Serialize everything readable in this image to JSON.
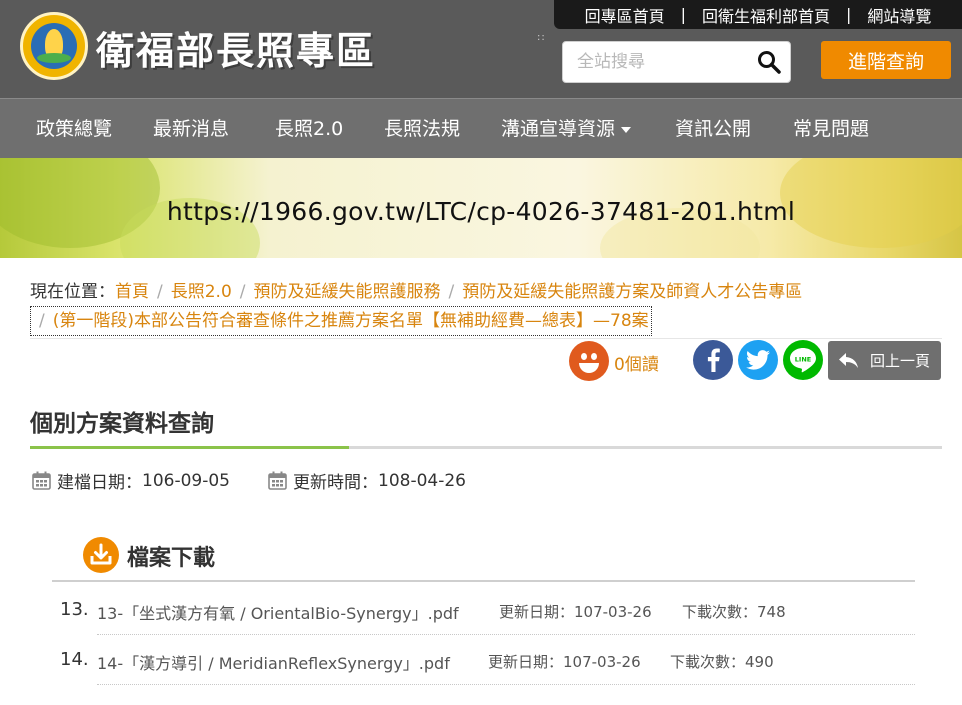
{
  "header": {
    "site_title": "衛福部長照專區",
    "top_links": [
      "回專區首頁",
      "回衛生福利部首頁",
      "網站導覽"
    ],
    "search_placeholder": "全站搜尋",
    "advanced_search": "進階查詢",
    "drag_dots": "::"
  },
  "nav": {
    "items": [
      "政策總覽",
      "最新消息",
      "長照2.0",
      "長照法規",
      "溝通宣導資源",
      "資訊公開",
      "常見問題"
    ]
  },
  "banner": {
    "url": "https://1966.gov.tw/LTC/cp-4026-37481-201.html"
  },
  "breadcrumb": {
    "label": "現在位置：",
    "items": [
      "首頁",
      "長照2.0",
      "預防及延緩失能照護服務",
      "預防及延緩失能照護方案及師資人才公告專區",
      "(第一階段)本部公告符合審查條件之推薦方案名單【無補助經費—總表】—78案"
    ],
    "separator": "/"
  },
  "tools": {
    "views": "0個讀",
    "back_label": "回上一頁",
    "line_label": "LINE"
  },
  "section": {
    "title": "個別方案資料查詢"
  },
  "dates": {
    "created_label": "建檔日期：",
    "created": "106-09-05",
    "updated_label": "更新時間：",
    "updated": "108-04-26"
  },
  "download": {
    "title": "檔案下載",
    "files": [
      {
        "num": "13.",
        "name": "13-「坐式漢方有氧 / OrientalBio-Synergy」.pdf",
        "updated_label": "更新日期：",
        "updated": "107-03-26",
        "count_label": "下載次數：",
        "count": "748"
      },
      {
        "num": "14.",
        "name": "14-「漢方導引 / MeridianReflexSynergy」.pdf",
        "updated_label": "更新日期：",
        "updated": "107-03-26",
        "count_label": "下載次數：",
        "count": "490"
      }
    ]
  },
  "colors": {
    "header_bg": "#5a5a5a",
    "nav_bg": "#6f6f6f",
    "accent_orange": "#f08a00",
    "link_orange": "#d8850f",
    "facebook": "#3b5998",
    "twitter": "#1da1f2",
    "line": "#00b900",
    "section_green": "#8bc34a"
  },
  "icons": [
    "logo-emblem",
    "search-icon",
    "smiley-icon",
    "facebook-icon",
    "twitter-icon",
    "line-icon",
    "back-arrow-icon",
    "calendar-icon",
    "download-icon"
  ]
}
